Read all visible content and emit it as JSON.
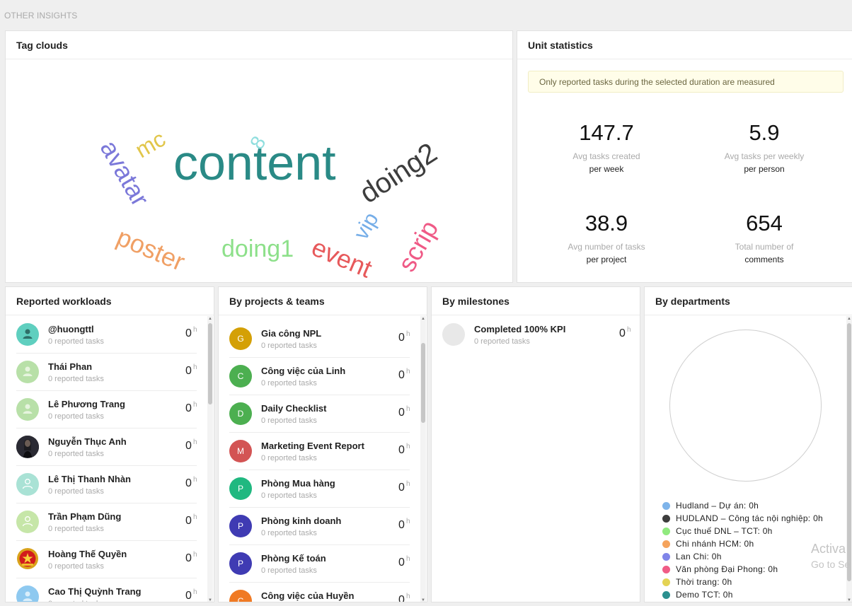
{
  "section_title": "OTHER INSIGHTS",
  "tag_cloud": {
    "title": "Tag clouds",
    "tags": [
      {
        "text": "content",
        "color": "#2a8a86"
      },
      {
        "text": "doing2",
        "color": "#3d3d3d"
      },
      {
        "text": "avatar",
        "color": "#7b78d9"
      },
      {
        "text": "mc",
        "color": "#e1c64a"
      },
      {
        "text": "8",
        "color": "#8fdede"
      },
      {
        "text": "poster",
        "color": "#f0a065"
      },
      {
        "text": "doing1",
        "color": "#8de08a"
      },
      {
        "text": "event",
        "color": "#e7595b"
      },
      {
        "text": "vip",
        "color": "#76aee8"
      },
      {
        "text": "scrip",
        "color": "#ef5a86"
      }
    ]
  },
  "unit_statistics": {
    "title": "Unit statistics",
    "notice": "Only reported tasks during the selected duration are measured",
    "stats": [
      {
        "value": "147.7",
        "label1": "Avg tasks created",
        "label2": "per week"
      },
      {
        "value": "5.9",
        "label1": "Avg tasks per weekly",
        "label2": "per person"
      },
      {
        "value": "38.9",
        "label1": "Avg number of tasks",
        "label2": "per project"
      },
      {
        "value": "654",
        "label1": "Total number of",
        "label2": "comments"
      }
    ]
  },
  "workloads": {
    "title": "Reported workloads",
    "unit": "h",
    "items": [
      {
        "name": "@huongttl",
        "sub": "0 reported tasks",
        "value": "0",
        "avatar": "teal-person"
      },
      {
        "name": "Thái Phan",
        "sub": "0 reported tasks",
        "value": "0",
        "avatar": "green-person"
      },
      {
        "name": "Lê Phương Trang",
        "sub": "0 reported tasks",
        "value": "0",
        "avatar": "green-person"
      },
      {
        "name": "Nguyễn Thục Anh",
        "sub": "0 reported tasks",
        "value": "0",
        "avatar": "photo"
      },
      {
        "name": "Lê Thị Thanh Nhàn",
        "sub": "0 reported tasks",
        "value": "0",
        "avatar": "mint-outline"
      },
      {
        "name": "Trần Phạm Dũng",
        "sub": "0 reported tasks",
        "value": "0",
        "avatar": "lime-outline"
      },
      {
        "name": "Hoàng Thế Quyền",
        "sub": "0 reported tasks",
        "value": "0",
        "avatar": "emblem"
      },
      {
        "name": "Cao Thị Quỳnh Trang",
        "sub": "0 reported tasks",
        "value": "0",
        "avatar": "blue-person"
      }
    ]
  },
  "projects": {
    "title": "By projects & teams",
    "unit": "h",
    "items": [
      {
        "name": "Gia công NPL",
        "sub": "0 reported tasks",
        "value": "0",
        "initial": "G",
        "color": "#d4a006"
      },
      {
        "name": "Công việc của Linh",
        "sub": "0 reported tasks",
        "value": "0",
        "initial": "C",
        "color": "#4caf50"
      },
      {
        "name": "Daily Checklist",
        "sub": "0 reported tasks",
        "value": "0",
        "initial": "D",
        "color": "#4caf50"
      },
      {
        "name": "Marketing Event Report",
        "sub": "0 reported tasks",
        "value": "0",
        "initial": "M",
        "color": "#d35454"
      },
      {
        "name": "Phòng Mua hàng",
        "sub": "0 reported tasks",
        "value": "0",
        "initial": "P",
        "color": "#20b880"
      },
      {
        "name": "Phòng kinh doanh",
        "sub": "0 reported tasks",
        "value": "0",
        "initial": "P",
        "color": "#3f3bb3"
      },
      {
        "name": "Phòng Kế toán",
        "sub": "0 reported tasks",
        "value": "0",
        "initial": "P",
        "color": "#3f3bb3"
      },
      {
        "name": "Công việc của Huyền",
        "sub": "0 reported tasks",
        "value": "0",
        "initial": "C",
        "color": "#f07a24"
      }
    ]
  },
  "milestones": {
    "title": "By milestones",
    "unit": "h",
    "items": [
      {
        "name": "Completed 100% KPI",
        "sub": "0 reported tasks",
        "value": "0"
      }
    ]
  },
  "departments": {
    "title": "By departments",
    "legend": [
      {
        "label": "Hudland – Dự án: 0h",
        "color": "#7eb4ea"
      },
      {
        "label": "HUDLAND – Công tác nội nghiệp: 0h",
        "color": "#3d3d3d"
      },
      {
        "label": "Cục thuế DNL – TCT: 0h",
        "color": "#90ea7f"
      },
      {
        "label": "Chi nhánh HCM: 0h",
        "color": "#f5a35c"
      },
      {
        "label": "Lan Chi: 0h",
        "color": "#8085e9"
      },
      {
        "label": "Văn phòng Đại Phong: 0h",
        "color": "#f05c86"
      },
      {
        "label": "Thời trang: 0h",
        "color": "#e4d354"
      },
      {
        "label": "Demo TCT: 0h",
        "color": "#2b908f"
      }
    ]
  },
  "watermark": {
    "line1": "Activa",
    "line2": "Go to Se"
  }
}
